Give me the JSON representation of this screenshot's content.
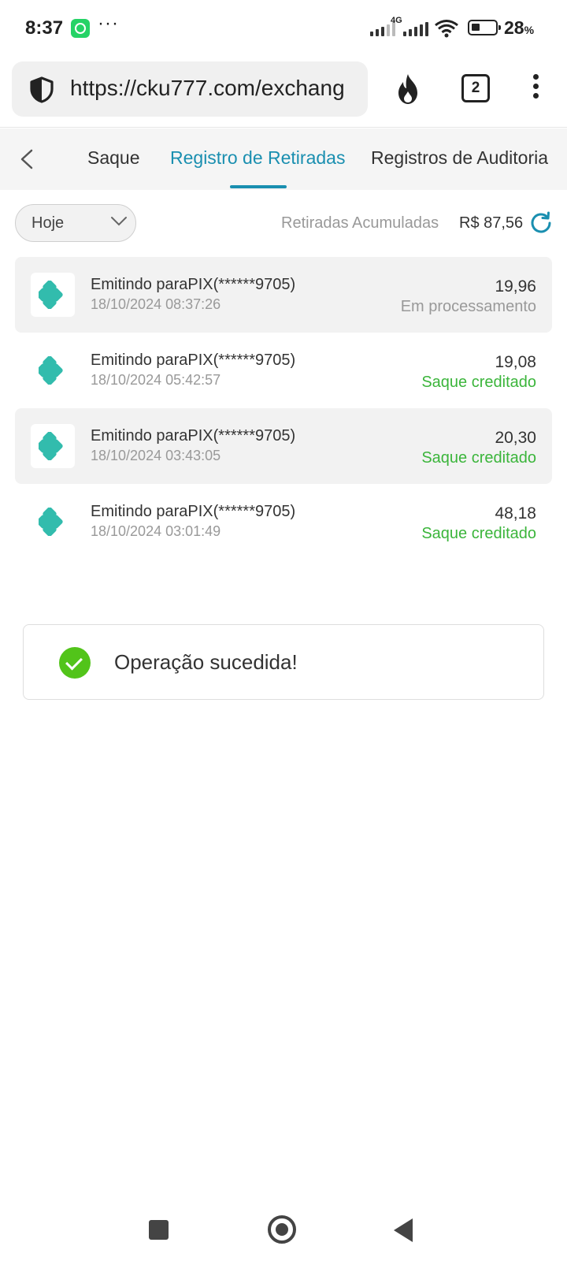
{
  "status_bar": {
    "time": "8:37",
    "more": "···",
    "network": "4G",
    "battery": "28",
    "battery_unit": "%"
  },
  "browser": {
    "url": "https://cku777.com/exchang",
    "tab_count": "2",
    "icons": [
      "shield-icon",
      "fire-icon",
      "tabs-icon",
      "menu-icon"
    ]
  },
  "tabs": {
    "items": [
      {
        "label": "Saque"
      },
      {
        "label": "Registro de Retiradas"
      },
      {
        "label": "Registros de Auditoria"
      }
    ],
    "active": "Registro de Retiradas",
    "accent": "#1a8fb0"
  },
  "filter": {
    "selected": "Hoje",
    "accumulated_label": "Retiradas Acumuladas",
    "accumulated_value": "R$ 87,56"
  },
  "records": [
    {
      "title": "Emitindo paraPIX(******9705)",
      "date": "18/10/2024 08:37:26",
      "amount": "19,96",
      "status": "Em processamento"
    },
    {
      "title": "Emitindo paraPIX(******9705)",
      "date": "18/10/2024 05:42:57",
      "amount": "19,08",
      "status": "Saque creditado"
    },
    {
      "title": "Emitindo paraPIX(******9705)",
      "date": "18/10/2024 03:43:05",
      "amount": "20,30",
      "status": "Saque creditado"
    },
    {
      "title": "Emitindo paraPIX(******9705)",
      "date": "18/10/2024 03:01:49",
      "amount": "48,18",
      "status": "Saque creditado"
    }
  ],
  "colors": {
    "credited": "#3bb53b",
    "processing": "#999999",
    "pix": "#32bcad",
    "success": "#52c41a"
  },
  "toast": {
    "message": "Operação sucedida!"
  }
}
